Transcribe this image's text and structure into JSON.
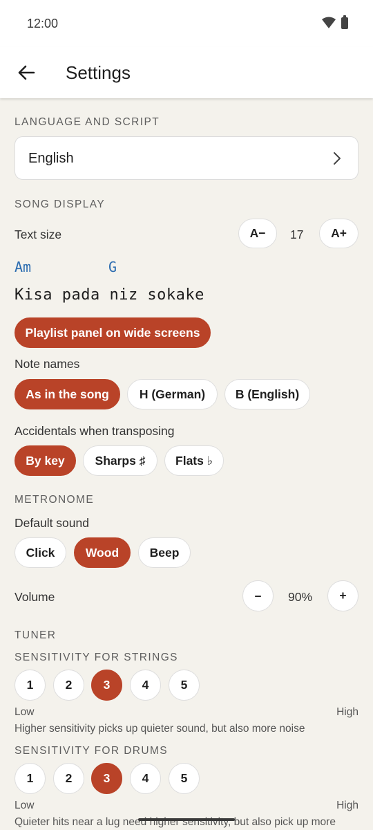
{
  "status_bar": {
    "time": "12:00"
  },
  "app_bar": {
    "title": "Settings"
  },
  "language": {
    "header": "LANGUAGE AND SCRIPT",
    "value": "English"
  },
  "song_display": {
    "header": "SONG DISPLAY",
    "text_size_label": "Text size",
    "decrease_label": "A−",
    "size_value": "17",
    "increase_label": "A+",
    "preview_chords": [
      "Am",
      "G"
    ],
    "preview_lyric": "Kisa pada niz sokake",
    "playlist_panel_label": "Playlist panel on wide screens",
    "note_names_label": "Note names",
    "note_names_options": [
      "As in the song",
      "H (German)",
      "B (English)"
    ],
    "accidentals_label": "Accidentals when transposing",
    "accidentals_options": [
      "By key",
      "Sharps ♯",
      "Flats ♭"
    ]
  },
  "metronome": {
    "header": "METRONOME",
    "default_sound_label": "Default sound",
    "sound_options": [
      "Click",
      "Wood",
      "Beep"
    ],
    "volume_label": "Volume",
    "volume_minus": "–",
    "volume_value": "90%",
    "volume_plus": "+"
  },
  "tuner": {
    "header": "TUNER",
    "strings_header": "SENSITIVITY FOR STRINGS",
    "strings_levels": [
      "1",
      "2",
      "3",
      "4",
      "5"
    ],
    "strings_low": "Low",
    "strings_high": "High",
    "strings_hint": "Higher sensitivity picks up quieter sound, but also more noise",
    "drums_header": "SENSITIVITY FOR DRUMS",
    "drums_levels": [
      "1",
      "2",
      "3",
      "4",
      "5"
    ],
    "drums_low": "Low",
    "drums_high": "High",
    "drums_hint": "Quieter hits near a lug need higher sensitivity, but also pick up more"
  },
  "colors": {
    "accent": "#b94328",
    "chord_blue": "#2b6cb0",
    "background": "#f4f2ec"
  }
}
